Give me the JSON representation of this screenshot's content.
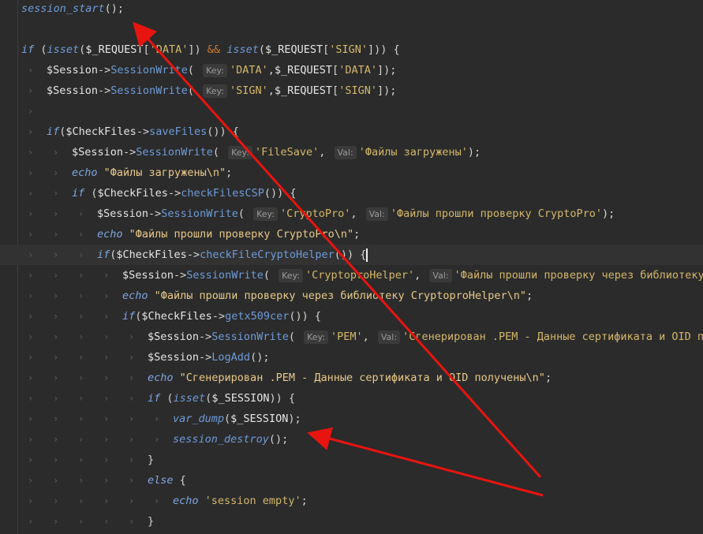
{
  "lines": [
    {
      "indent": 0,
      "parts": [
        [
          "fni",
          "session_start"
        ],
        [
          "pun",
          "();"
        ]
      ]
    },
    {
      "indent": 0,
      "parts": []
    },
    {
      "indent": 0,
      "fold": true,
      "parts": [
        [
          "kwi",
          "if"
        ],
        [
          "pun",
          " ("
        ],
        [
          "fni",
          "isset"
        ],
        [
          "pun",
          "("
        ],
        [
          "var",
          "$_REQUEST"
        ],
        [
          "pun",
          "["
        ],
        [
          "str",
          "'DATA'"
        ],
        [
          "pun",
          "]) "
        ],
        [
          "kw",
          "&&"
        ],
        [
          "pun",
          " "
        ],
        [
          "fni",
          "isset"
        ],
        [
          "pun",
          "("
        ],
        [
          "var",
          "$_REQUEST"
        ],
        [
          "pun",
          "["
        ],
        [
          "str",
          "'SIGN'"
        ],
        [
          "pun",
          "])) {"
        ]
      ]
    },
    {
      "indent": 1,
      "parts": [
        [
          "var",
          "$Session"
        ],
        [
          "pun",
          "->"
        ],
        [
          "fn",
          "SessionWrite"
        ],
        [
          "pun",
          "( "
        ],
        [
          "hint",
          "Key:"
        ],
        [
          "str",
          "'DATA'"
        ],
        [
          "pun",
          ","
        ],
        [
          "var",
          "$_REQUEST"
        ],
        [
          "pun",
          "["
        ],
        [
          "str",
          "'DATA'"
        ],
        [
          "pun",
          "]);"
        ]
      ]
    },
    {
      "indent": 1,
      "parts": [
        [
          "var",
          "$Session"
        ],
        [
          "pun",
          "->"
        ],
        [
          "fn",
          "SessionWrite"
        ],
        [
          "pun",
          "( "
        ],
        [
          "hint",
          "Key:"
        ],
        [
          "str",
          "'SIGN'"
        ],
        [
          "pun",
          ","
        ],
        [
          "var",
          "$_REQUEST"
        ],
        [
          "pun",
          "["
        ],
        [
          "str",
          "'SIGN'"
        ],
        [
          "pun",
          "]);"
        ]
      ]
    },
    {
      "indent": 1,
      "parts": []
    },
    {
      "indent": 1,
      "fold": true,
      "parts": [
        [
          "kwi",
          "if"
        ],
        [
          "pun",
          "("
        ],
        [
          "var",
          "$CheckFiles"
        ],
        [
          "pun",
          "->"
        ],
        [
          "fn",
          "saveFiles"
        ],
        [
          "pun",
          "()) {"
        ]
      ]
    },
    {
      "indent": 2,
      "parts": [
        [
          "var",
          "$Session"
        ],
        [
          "pun",
          "->"
        ],
        [
          "fn",
          "SessionWrite"
        ],
        [
          "pun",
          "( "
        ],
        [
          "hint",
          "Key:"
        ],
        [
          "str",
          "'FileSave'"
        ],
        [
          "pun",
          ", "
        ],
        [
          "hint",
          "Val:"
        ],
        [
          "str",
          "'Файлы загружены'"
        ],
        [
          "pun",
          ");"
        ]
      ]
    },
    {
      "indent": 2,
      "parts": [
        [
          "kwi",
          "echo"
        ],
        [
          "pun",
          " "
        ],
        [
          "strr",
          "\"Файлы загружены\\n\""
        ],
        [
          "pun",
          ";"
        ]
      ]
    },
    {
      "indent": 2,
      "fold": true,
      "parts": [
        [
          "kwi",
          "if"
        ],
        [
          "pun",
          " ("
        ],
        [
          "var",
          "$CheckFiles"
        ],
        [
          "pun",
          "->"
        ],
        [
          "fn",
          "checkFilesCSP"
        ],
        [
          "pun",
          "()) {"
        ]
      ]
    },
    {
      "indent": 3,
      "parts": [
        [
          "var",
          "$Session"
        ],
        [
          "pun",
          "->"
        ],
        [
          "fn",
          "SessionWrite"
        ],
        [
          "pun",
          "( "
        ],
        [
          "hint",
          "Key:"
        ],
        [
          "str",
          "'CryptoPro'"
        ],
        [
          "pun",
          ", "
        ],
        [
          "hint",
          "Val:"
        ],
        [
          "str",
          "'Файлы прошли проверку CryptoPro'"
        ],
        [
          "pun",
          ");"
        ]
      ]
    },
    {
      "indent": 3,
      "parts": [
        [
          "kwi",
          "echo"
        ],
        [
          "pun",
          " "
        ],
        [
          "strr",
          "\"Файлы прошли проверку CryptoPro\\n\""
        ],
        [
          "pun",
          ";"
        ]
      ]
    },
    {
      "indent": 3,
      "fold": true,
      "current": true,
      "parts": [
        [
          "kwi",
          "if"
        ],
        [
          "pun",
          "("
        ],
        [
          "var",
          "$CheckFiles"
        ],
        [
          "pun",
          "->"
        ],
        [
          "fn",
          "checkFileCryptoHelper"
        ],
        [
          "pun",
          "()) {"
        ],
        [
          "cursor",
          ""
        ]
      ]
    },
    {
      "indent": 4,
      "parts": [
        [
          "var",
          "$Session"
        ],
        [
          "pun",
          "->"
        ],
        [
          "fn",
          "SessionWrite"
        ],
        [
          "pun",
          "( "
        ],
        [
          "hint",
          "Key:"
        ],
        [
          "str",
          "'CryptoproHelper'"
        ],
        [
          "pun",
          ", "
        ],
        [
          "hint",
          "Val:"
        ],
        [
          "str",
          "'Файлы прошли проверку через библиотеку Cr"
        ]
      ]
    },
    {
      "indent": 4,
      "parts": [
        [
          "kwi",
          "echo"
        ],
        [
          "pun",
          " "
        ],
        [
          "strr",
          "\"Файлы прошли проверку через библиотеку CryptoproHelper\\n\""
        ],
        [
          "pun",
          ";"
        ]
      ]
    },
    {
      "indent": 4,
      "fold": true,
      "parts": [
        [
          "kwi",
          "if"
        ],
        [
          "pun",
          "("
        ],
        [
          "var",
          "$CheckFiles"
        ],
        [
          "pun",
          "->"
        ],
        [
          "fn",
          "getx509cer"
        ],
        [
          "pun",
          "()) {"
        ]
      ]
    },
    {
      "indent": 5,
      "parts": [
        [
          "var",
          "$Session"
        ],
        [
          "pun",
          "->"
        ],
        [
          "fn",
          "SessionWrite"
        ],
        [
          "pun",
          "( "
        ],
        [
          "hint",
          "Key:"
        ],
        [
          "str",
          "'PEM'"
        ],
        [
          "pun",
          ", "
        ],
        [
          "hint",
          "Val:"
        ],
        [
          "str",
          "'Сгенерирован .PEM - Данные сертификата и OID полу"
        ]
      ]
    },
    {
      "indent": 5,
      "parts": [
        [
          "var",
          "$Session"
        ],
        [
          "pun",
          "->"
        ],
        [
          "fn",
          "LogAdd"
        ],
        [
          "pun",
          "();"
        ]
      ]
    },
    {
      "indent": 5,
      "parts": [
        [
          "kwi",
          "echo"
        ],
        [
          "pun",
          " "
        ],
        [
          "strr",
          "\"Сгенерирован .PEM - Данные сертификата и OID получены\\n\""
        ],
        [
          "pun",
          ";"
        ]
      ]
    },
    {
      "indent": 5,
      "fold": true,
      "parts": [
        [
          "kwi",
          "if"
        ],
        [
          "pun",
          " ("
        ],
        [
          "fni",
          "isset"
        ],
        [
          "pun",
          "("
        ],
        [
          "var",
          "$_SESSION"
        ],
        [
          "pun",
          ")) {"
        ]
      ]
    },
    {
      "indent": 6,
      "parts": [
        [
          "fni",
          "var_dump"
        ],
        [
          "pun",
          "("
        ],
        [
          "var",
          "$_SESSION"
        ],
        [
          "pun",
          ");"
        ]
      ]
    },
    {
      "indent": 6,
      "parts": [
        [
          "fni",
          "session_destroy"
        ],
        [
          "pun",
          "();"
        ]
      ]
    },
    {
      "indent": 5,
      "parts": [
        [
          "pun",
          "}"
        ]
      ]
    },
    {
      "indent": 5,
      "parts": [
        [
          "kwi",
          "else"
        ],
        [
          "pun",
          " {"
        ]
      ]
    },
    {
      "indent": 6,
      "parts": [
        [
          "kwi",
          "echo"
        ],
        [
          "pun",
          " "
        ],
        [
          "str",
          "'session empty'"
        ],
        [
          "pun",
          ";"
        ]
      ]
    },
    {
      "indent": 5,
      "parts": [
        [
          "pun",
          "}"
        ]
      ]
    }
  ],
  "colors": {
    "background": "#2b2b2b",
    "arrow": "#e8140f"
  }
}
